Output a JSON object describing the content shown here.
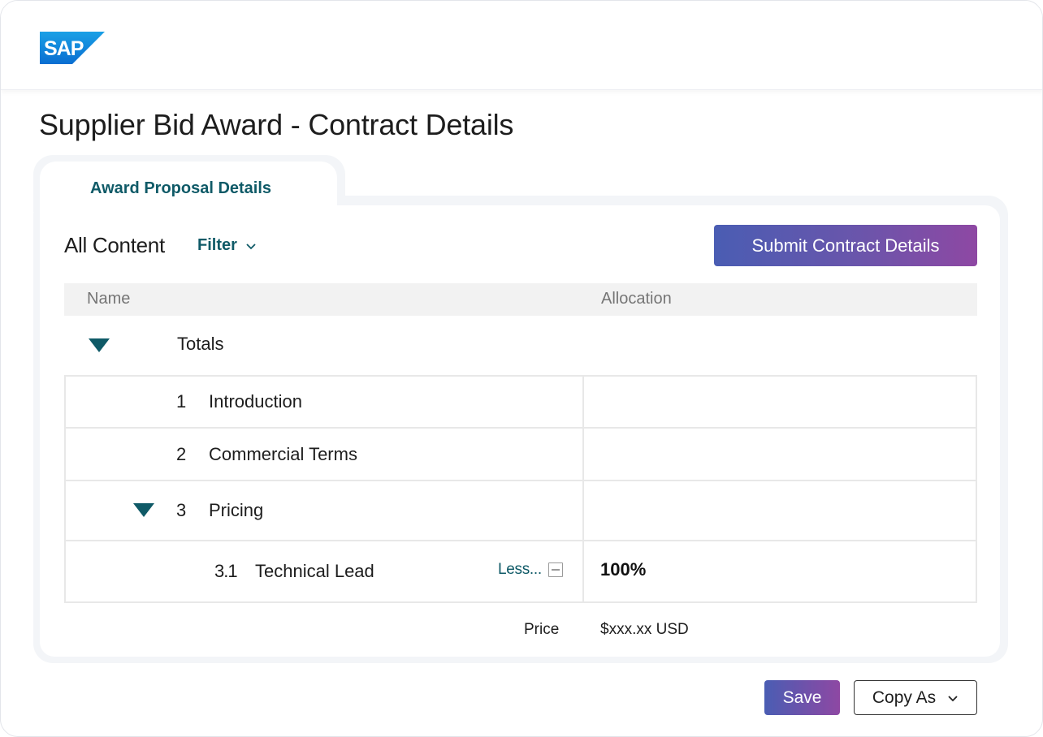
{
  "header": {
    "logo_text": "SAP",
    "brand_color": "#0a6ed1"
  },
  "page": {
    "title": "Supplier Bid Award - Contract Details"
  },
  "tabs": [
    {
      "label": "Award Proposal Details",
      "active": true
    }
  ],
  "toolbar": {
    "all_content_label": "All Content",
    "filter_label": "Filter",
    "submit_label": "Submit Contract Details"
  },
  "table": {
    "columns": {
      "name": "Name",
      "allocation": "Allocation"
    },
    "totals_label": "Totals",
    "rows": [
      {
        "number": "1",
        "label": "Introduction",
        "allocation": ""
      },
      {
        "number": "2",
        "label": "Commercial Terms",
        "allocation": ""
      },
      {
        "number": "3",
        "label": "Pricing",
        "allocation": "",
        "expanded": true
      },
      {
        "number": "3.1",
        "label": "Technical Lead",
        "allocation": "100%",
        "toggle_label": "Less..."
      }
    ],
    "price_label": "Price",
    "price_value": "$xxx.xx USD"
  },
  "footer": {
    "save_label": "Save",
    "copy_label": "Copy As"
  },
  "colors": {
    "accent": "#0f5a67",
    "gradient_start": "#4a5db3",
    "gradient_end": "#8e48a3"
  }
}
